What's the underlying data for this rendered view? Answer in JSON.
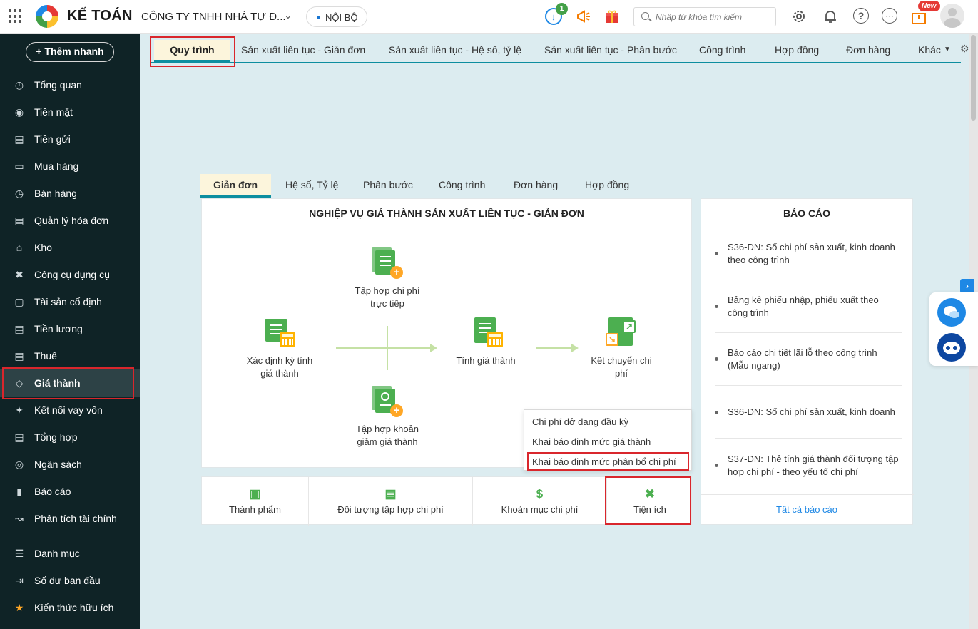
{
  "header": {
    "brand": "KẾ TOÁN",
    "company": "CÔNG TY TNHH NHÀ TỰ Đ...",
    "env_pill": "NỘI BỘ",
    "download_badge": "1",
    "search_placeholder": "Nhập từ khóa tìm kiếm",
    "new_badge": "New"
  },
  "sidebar": {
    "quick_add": "+ Thêm nhanh",
    "items": [
      {
        "label": "Tổng quan",
        "icon": "chart-icon"
      },
      {
        "label": "Tiền mặt",
        "icon": "money-bag-icon"
      },
      {
        "label": "Tiền gửi",
        "icon": "bank-icon"
      },
      {
        "label": "Mua hàng",
        "icon": "shopping-bag-icon"
      },
      {
        "label": "Bán hàng",
        "icon": "cart-icon"
      },
      {
        "label": "Quản lý hóa đơn",
        "icon": "invoice-icon"
      },
      {
        "label": "Kho",
        "icon": "warehouse-icon"
      },
      {
        "label": "Công cụ dụng cụ",
        "icon": "tools-icon"
      },
      {
        "label": "Tài sản cố định",
        "icon": "car-icon"
      },
      {
        "label": "Tiền lương",
        "icon": "salary-icon"
      },
      {
        "label": "Thuế",
        "icon": "tax-icon"
      },
      {
        "label": "Giá thành",
        "icon": "price-tag-icon"
      },
      {
        "label": "Kết nối vay vốn",
        "icon": "loan-icon"
      },
      {
        "label": "Tổng hợp",
        "icon": "summary-icon"
      },
      {
        "label": "Ngân sách",
        "icon": "budget-icon"
      },
      {
        "label": "Báo cáo",
        "icon": "bar-chart-icon"
      },
      {
        "label": "Phân tích tài chính",
        "icon": "analysis-icon"
      },
      {
        "label": "Danh mục",
        "icon": "list-icon"
      },
      {
        "label": "Số dư ban đầu",
        "icon": "opening-balance-icon"
      },
      {
        "label": "Kiến thức hữu ích",
        "icon": "knowledge-icon"
      }
    ]
  },
  "top_tabs": [
    "Quy trình",
    "Sản xuất liên tục - Giản đơn",
    "Sản xuất liên tục - Hệ số, tỷ lệ",
    "Sản xuất liên tục - Phân bước",
    "Công trình",
    "Hợp đồng",
    "Đơn hàng",
    "Khác"
  ],
  "sub_tabs": [
    "Giản đơn",
    "Hệ số, Tỷ lệ",
    "Phân bước",
    "Công trình",
    "Đơn hàng",
    "Hợp đồng"
  ],
  "process": {
    "title": "NGHIỆP VỤ GIÁ THÀNH SẢN XUẤT LIÊN TỤC - GIẢN ĐƠN",
    "step1": "Xác định kỳ tính giá thành",
    "step_top": "Tập hợp chi phí trực tiếp",
    "step_bottom": "Tập hợp khoản giảm giá thành",
    "step3": "Tính giá thành",
    "step4": "Kết chuyển chi phí"
  },
  "popup_menu": [
    "Chi phí dở dang đầu kỳ",
    "Khai báo định mức giá thành",
    "Khai báo định mức phân bổ chi phí"
  ],
  "bottom_bar": [
    "Thành phẩm",
    "Đối tượng tập hợp chi phí",
    "Khoản mục chi phí",
    "Tiện ích"
  ],
  "reports": {
    "title": "BÁO CÁO",
    "items": [
      "S36-DN: Số chi phí sản xuất, kinh doanh theo công trình",
      "Bảng kê phiếu nhập, phiếu xuất theo công trình",
      "Báo cáo chi tiết lãi lỗ theo công trình (Mẫu ngang)",
      "S36-DN: Số chi phí sản xuất, kinh doanh",
      "S37-DN: Thẻ tính giá thành đối tượng tập hợp chi phí - theo yếu tố chi phí"
    ],
    "all": "Tất cả báo cáo"
  },
  "colors": {
    "accent": "#0d8ea0",
    "sidebar_bg": "#0f2326",
    "highlight": "#d9262c",
    "active_tab_bg": "#fcf5dc",
    "content_bg": "#dcecf0"
  }
}
